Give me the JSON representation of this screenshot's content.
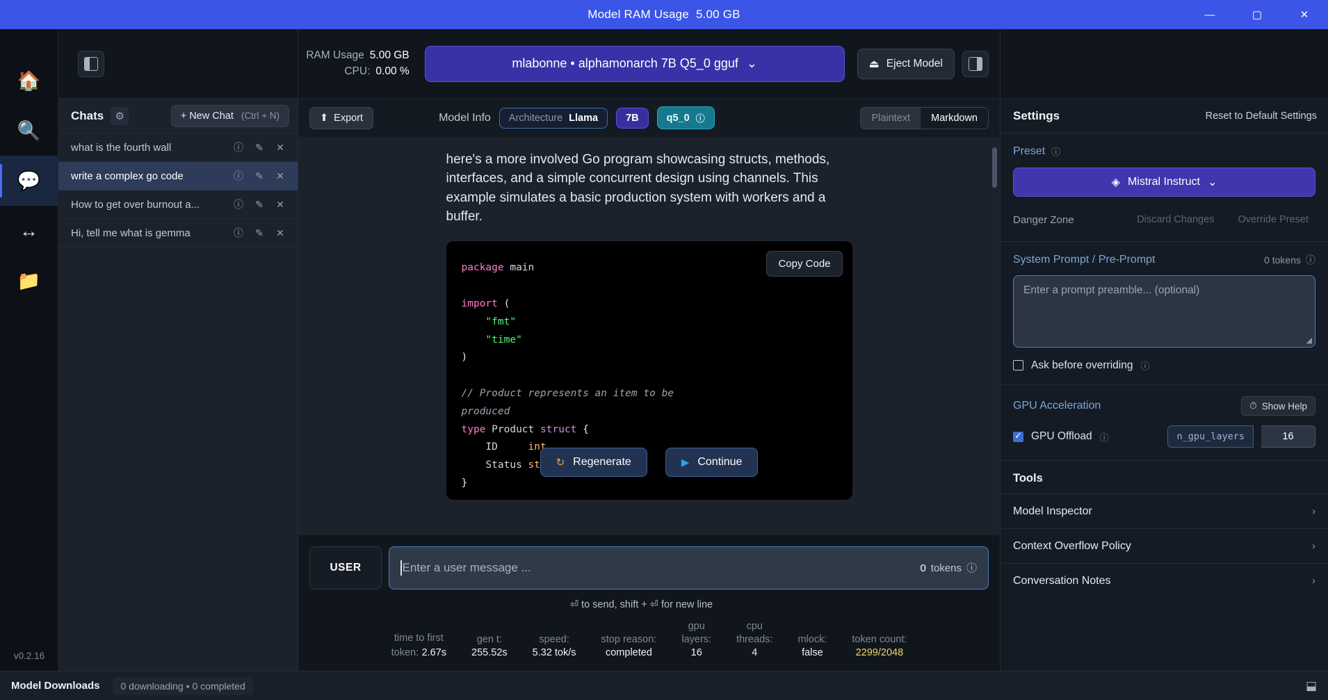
{
  "titlebar": {
    "title": "Model RAM Usage",
    "value": "5.00 GB",
    "minimize": "—",
    "maximize": "▢",
    "close": "✕"
  },
  "rail": {
    "items": [
      {
        "name": "home",
        "glyph": "🏠"
      },
      {
        "name": "search",
        "glyph": "🔍"
      },
      {
        "name": "chat",
        "glyph": "💬"
      },
      {
        "name": "compare",
        "glyph": "↔"
      },
      {
        "name": "folder",
        "glyph": "📁"
      }
    ],
    "version": "v0.2.16"
  },
  "sidebar": {
    "title": "Chats",
    "gear_icon": "⚙",
    "new_chat_label": "+ New Chat",
    "new_chat_shortcut": "(Ctrl + N)",
    "chats": [
      {
        "label": "what is the fourth wall",
        "active": false
      },
      {
        "label": "write a complex go code",
        "active": true
      },
      {
        "label": "How to get over burnout a...",
        "active": false
      },
      {
        "label": "Hi, tell me what is gemma",
        "active": false
      }
    ],
    "row_actions": {
      "info": "ⓘ",
      "edit": "✎",
      "close": "✕"
    }
  },
  "topbar": {
    "ram_label": "RAM Usage",
    "ram_value": "5.00 GB",
    "cpu_label": "CPU:",
    "cpu_value": "0.00 %",
    "model_name": "mlabonne • alphamonarch 7B Q5_0 gguf",
    "model_chevron": "⌄",
    "eject_label": "Eject Model",
    "eject_icon": "⏏"
  },
  "modelinfo": {
    "export_label": "Export",
    "export_icon": "⬆",
    "label": "Model Info",
    "arch_key": "Architecture",
    "arch_value": "Llama",
    "size": "7B",
    "quant": "q5_0",
    "info_icon": "ⓘ",
    "format_plaintext": "Plaintext",
    "format_markdown": "Markdown"
  },
  "message": {
    "paragraph": "here's a more involved Go program showcasing structs, methods, interfaces, and a simple concurrent design using channels. This example simulates a basic production system with workers and a buffer.",
    "copy_code_label": "Copy Code",
    "code_lines": [
      {
        "parts": [
          {
            "t": "package ",
            "c": "t-kw"
          },
          {
            "t": "main",
            "c": "t-fn"
          }
        ]
      },
      {
        "parts": []
      },
      {
        "parts": [
          {
            "t": "import ",
            "c": "t-kw"
          },
          {
            "t": "(",
            "c": "t-pl"
          }
        ]
      },
      {
        "parts": [
          {
            "t": "    \"fmt\"",
            "c": "t-str"
          }
        ]
      },
      {
        "parts": [
          {
            "t": "    \"time\"",
            "c": "t-str"
          }
        ]
      },
      {
        "parts": [
          {
            "t": ")",
            "c": "t-pl"
          }
        ]
      },
      {
        "parts": []
      },
      {
        "parts": [
          {
            "t": "// Product represents an item to be",
            "c": "t-com"
          }
        ]
      },
      {
        "parts": [
          {
            "t": "produced",
            "c": "t-com"
          }
        ]
      },
      {
        "parts": [
          {
            "t": "type ",
            "c": "t-kw"
          },
          {
            "t": "Product ",
            "c": "t-fn"
          },
          {
            "t": "struct ",
            "c": "t-typ"
          },
          {
            "t": "{",
            "c": "t-pl"
          }
        ]
      },
      {
        "parts": [
          {
            "t": "    ID     ",
            "c": "t-fn"
          },
          {
            "t": "int",
            "c": "t-fld"
          }
        ]
      },
      {
        "parts": [
          {
            "t": "    Status ",
            "c": "t-fn"
          },
          {
            "t": "stri",
            "c": "t-fld"
          }
        ]
      },
      {
        "parts": [
          {
            "t": "}",
            "c": "t-pl"
          }
        ]
      }
    ],
    "regenerate_label": "Regenerate",
    "regenerate_icon": "↻",
    "continue_label": "Continue",
    "continue_icon": "▶"
  },
  "input": {
    "role_label": "USER",
    "placeholder": "Enter a user message ...",
    "token_count": "0",
    "token_label": "tokens",
    "token_info": "ⓘ",
    "hint": "⏎ to send, shift + ⏎ for new line"
  },
  "stats": [
    {
      "key": "time to first",
      "key2": "token:",
      "value": "2.67s",
      "inline": true
    },
    {
      "key": "gen t:",
      "value": "255.52s"
    },
    {
      "key": "speed:",
      "value": "5.32 tok/s"
    },
    {
      "key": "stop reason:",
      "value": "completed"
    },
    {
      "key": "gpu",
      "key2": "layers:",
      "value": "16"
    },
    {
      "key": "cpu",
      "key2": "threads:",
      "value": "4"
    },
    {
      "key": "mlock:",
      "value": "false"
    },
    {
      "key": "token count:",
      "value": "2299/2048",
      "accent": true
    }
  ],
  "settings": {
    "title": "Settings",
    "reset_label": "Reset to Default Settings",
    "preset": {
      "label": "Preset",
      "info": "ⓘ",
      "value": "Mistral Instruct",
      "icon": "◈",
      "chevron": "⌄",
      "danger_label": "Danger Zone",
      "discard_label": "Discard Changes",
      "override_label": "Override Preset"
    },
    "system_prompt": {
      "label": "System Prompt / Pre-Prompt",
      "token_count": "0 tokens",
      "token_info": "ⓘ",
      "placeholder": "Enter a prompt preamble... (optional)",
      "ask_before_label": "Ask before overriding",
      "ask_before_info": "ⓘ",
      "ask_before_checked": false
    },
    "gpu": {
      "label": "GPU Acceleration",
      "show_help": "Show Help",
      "help_icon": "⏱",
      "offload_label": "GPU Offload",
      "offload_info": "ⓘ",
      "offload_checked": true,
      "param_name": "n_gpu_layers",
      "param_value": "16"
    },
    "tools_title": "Tools",
    "tools": [
      {
        "label": "Model Inspector",
        "chevron": "›"
      },
      {
        "label": "Context Overflow Policy",
        "chevron": "›"
      },
      {
        "label": "Conversation Notes",
        "chevron": "›"
      }
    ]
  },
  "bottombar": {
    "title": "Model Downloads",
    "status": "0 downloading • 0 completed",
    "right_icon": "⬓"
  }
}
